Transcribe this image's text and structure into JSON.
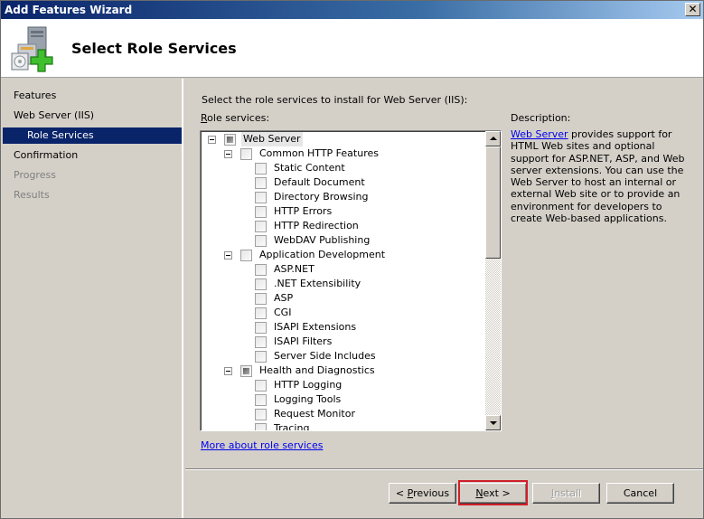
{
  "window": {
    "title": "Add Features Wizard",
    "close_label": "✕"
  },
  "header": {
    "title": "Select Role Services",
    "icon": "server-add-icon"
  },
  "nav": {
    "items": [
      {
        "label": "Features",
        "state": "normal",
        "level": 0
      },
      {
        "label": "Web Server (IIS)",
        "state": "normal",
        "level": 0
      },
      {
        "label": "Role Services",
        "state": "active",
        "level": 1
      },
      {
        "label": "Confirmation",
        "state": "normal",
        "level": 0
      },
      {
        "label": "Progress",
        "state": "disabled",
        "level": 0
      },
      {
        "label": "Results",
        "state": "disabled",
        "level": 0
      }
    ]
  },
  "main": {
    "instruction": "Select the role services to install for Web Server (IIS):",
    "role_services_label_accel": "R",
    "role_services_label_rest": "ole services:",
    "tree": [
      {
        "label": "Web Server",
        "level": 0,
        "expander": true,
        "check": "partial",
        "selected": true
      },
      {
        "label": "Common HTTP Features",
        "level": 1,
        "expander": true,
        "check": "unchecked"
      },
      {
        "label": "Static Content",
        "level": 2,
        "expander": false,
        "check": "unchecked"
      },
      {
        "label": "Default Document",
        "level": 2,
        "expander": false,
        "check": "unchecked"
      },
      {
        "label": "Directory Browsing",
        "level": 2,
        "expander": false,
        "check": "unchecked"
      },
      {
        "label": "HTTP Errors",
        "level": 2,
        "expander": false,
        "check": "unchecked"
      },
      {
        "label": "HTTP Redirection",
        "level": 2,
        "expander": false,
        "check": "unchecked"
      },
      {
        "label": "WebDAV Publishing",
        "level": 2,
        "expander": false,
        "check": "unchecked"
      },
      {
        "label": "Application Development",
        "level": 1,
        "expander": true,
        "check": "unchecked"
      },
      {
        "label": "ASP.NET",
        "level": 2,
        "expander": false,
        "check": "unchecked"
      },
      {
        "label": ".NET Extensibility",
        "level": 2,
        "expander": false,
        "check": "unchecked"
      },
      {
        "label": "ASP",
        "level": 2,
        "expander": false,
        "check": "unchecked"
      },
      {
        "label": "CGI",
        "level": 2,
        "expander": false,
        "check": "unchecked"
      },
      {
        "label": "ISAPI Extensions",
        "level": 2,
        "expander": false,
        "check": "unchecked"
      },
      {
        "label": "ISAPI Filters",
        "level": 2,
        "expander": false,
        "check": "unchecked"
      },
      {
        "label": "Server Side Includes",
        "level": 2,
        "expander": false,
        "check": "unchecked"
      },
      {
        "label": "Health and Diagnostics",
        "level": 1,
        "expander": true,
        "check": "partial"
      },
      {
        "label": "HTTP Logging",
        "level": 2,
        "expander": false,
        "check": "unchecked"
      },
      {
        "label": "Logging Tools",
        "level": 2,
        "expander": false,
        "check": "unchecked"
      },
      {
        "label": "Request Monitor",
        "level": 2,
        "expander": false,
        "check": "unchecked"
      },
      {
        "label": "Tracing",
        "level": 2,
        "expander": false,
        "check": "unchecked"
      }
    ],
    "more_link": "More about role services",
    "description_title": "Description:",
    "description_link": "Web Server",
    "description_text": " provides support for HTML Web sites and optional support for ASP.NET, ASP, and Web server extensions. You can use the Web Server to host an internal or external Web site or to provide an environment for developers to create Web-based applications."
  },
  "buttons": {
    "previous": {
      "prefix": "< ",
      "accel": "P",
      "rest": "revious",
      "enabled": true
    },
    "next": {
      "prefix": "",
      "accel": "N",
      "rest": "ext >",
      "enabled": true,
      "highlighted": true
    },
    "install": {
      "prefix": "",
      "accel": "I",
      "rest": "nstall",
      "enabled": false
    },
    "cancel": {
      "label": "Cancel",
      "enabled": true
    }
  },
  "colors": {
    "highlight_border": "#d0202a",
    "nav_active_bg": "#0a246a",
    "link": "#0000ee"
  }
}
